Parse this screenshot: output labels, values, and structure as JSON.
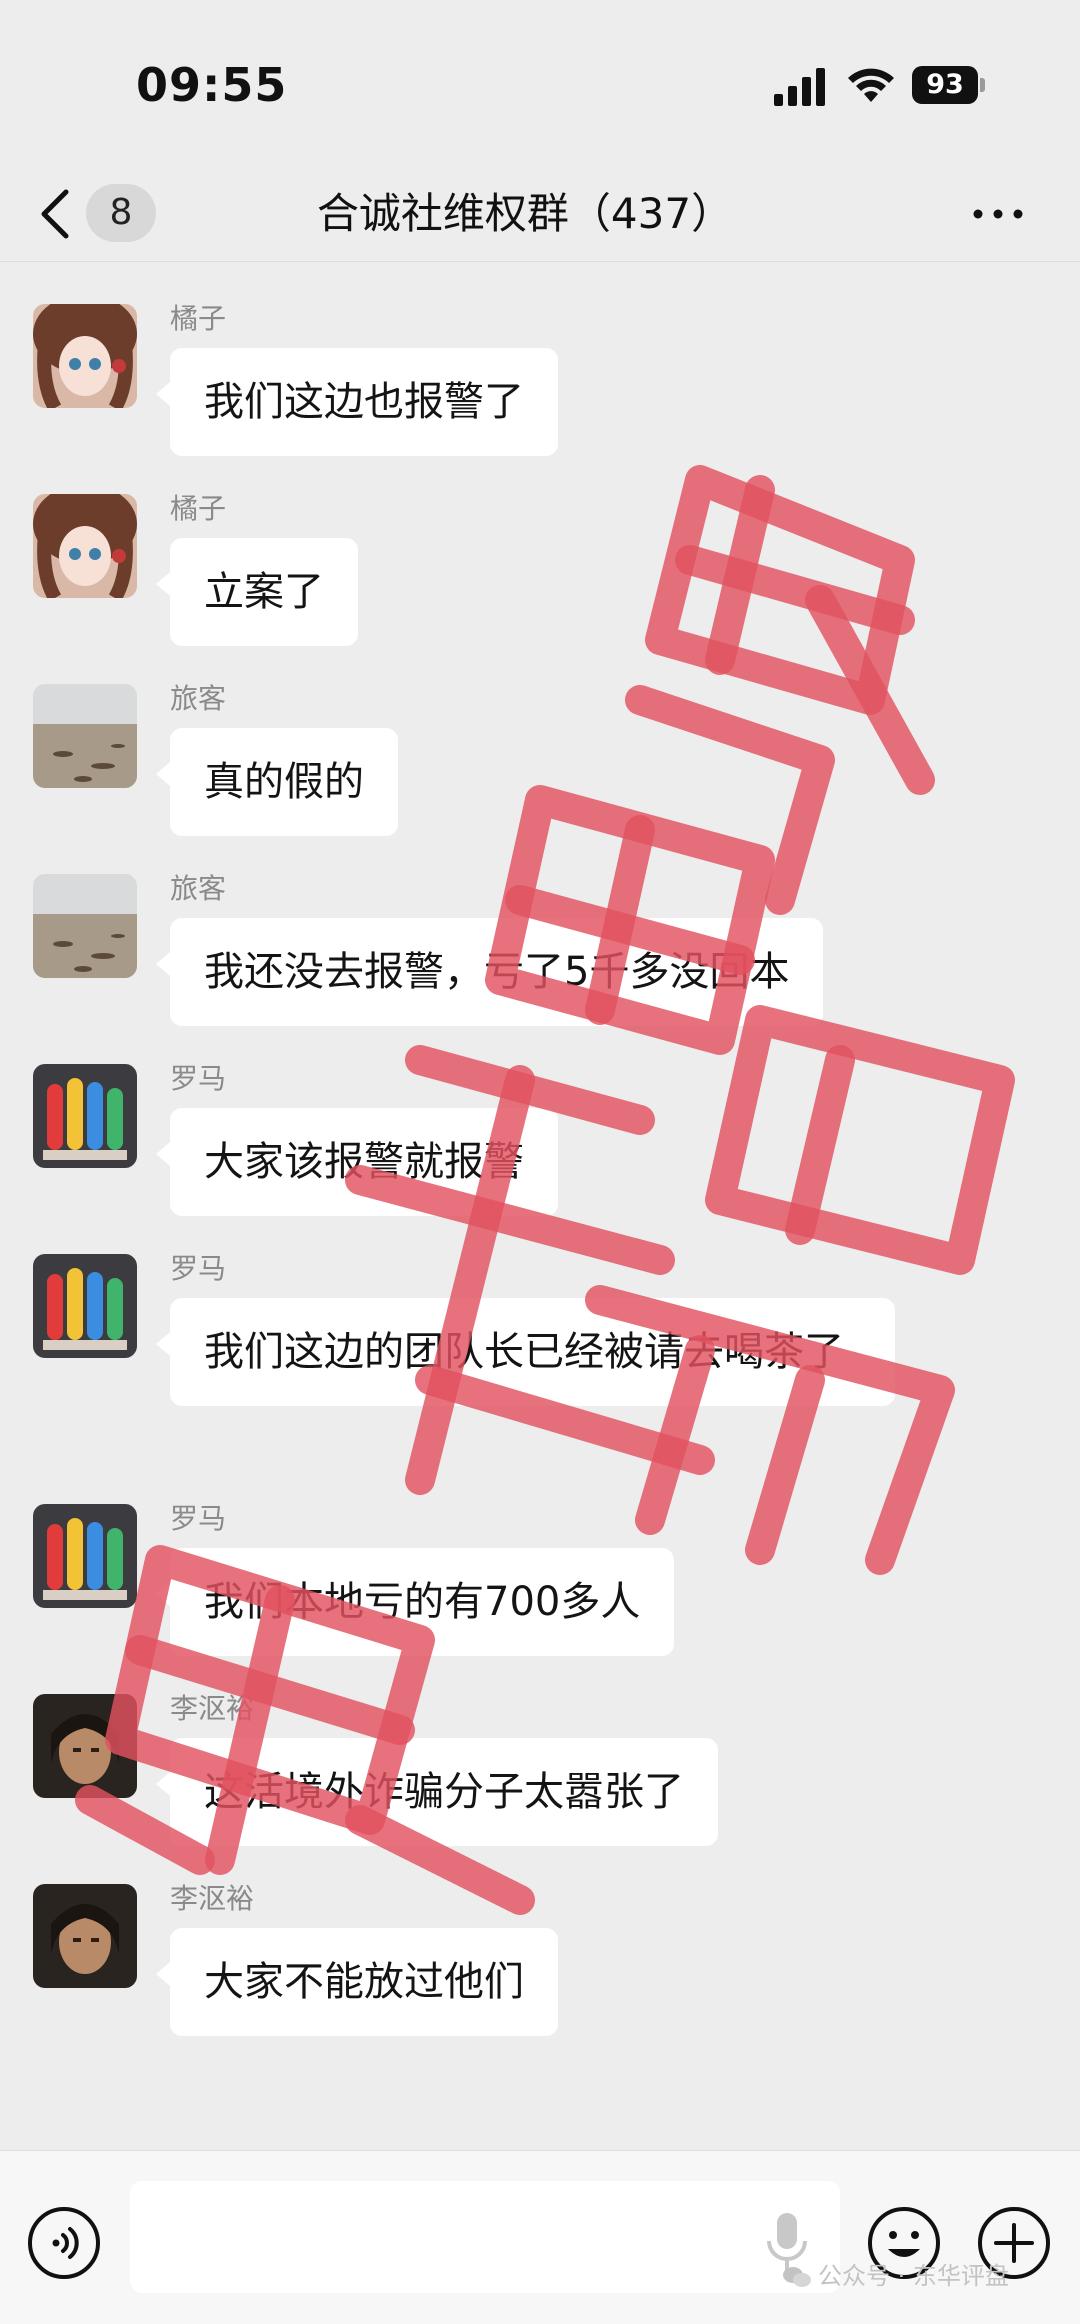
{
  "status_bar": {
    "time": "09:55",
    "battery": "93"
  },
  "nav": {
    "unread_count": "8",
    "title": "合诚社维权群（437）"
  },
  "messages": [
    {
      "sender": "橘子",
      "text": "我们这边也报警了",
      "avatar": "anime-girl-avatar"
    },
    {
      "sender": "橘子",
      "text": "立案了",
      "avatar": "anime-girl-avatar"
    },
    {
      "sender": "旅客",
      "text": "真的假的",
      "avatar": "beach-avatar"
    },
    {
      "sender": "旅客",
      "text": "我还没去报警，亏了5千多没回本",
      "avatar": "beach-avatar"
    },
    {
      "sender": "罗马",
      "text": "大家该报警就报警",
      "avatar": "colorful-figure-avatar"
    },
    {
      "sender": "罗马",
      "text": "我们这边的团队长已经被请去喝茶了",
      "avatar": "colorful-figure-avatar"
    },
    {
      "sender": "罗马",
      "text": "我们本地亏的有700多人",
      "avatar": "colorful-figure-avatar"
    },
    {
      "sender": "李沤裕",
      "text": "这活境外诈骗分子太嚣张了",
      "avatar": "man-portrait-avatar"
    },
    {
      "sender": "李沤裕",
      "text": "大家不能放过他们",
      "avatar": "man-portrait-avatar"
    }
  ],
  "input": {
    "placeholder": ""
  },
  "watermark": {
    "credit": "公众号 · 东华评盘"
  },
  "overlay_stamp": {
    "color": "#e2525f",
    "description_icon": "red-stamp-characters"
  },
  "colors": {
    "background": "#ededed",
    "bubble": "#ffffff",
    "sender_name": "#8a8a8a"
  }
}
